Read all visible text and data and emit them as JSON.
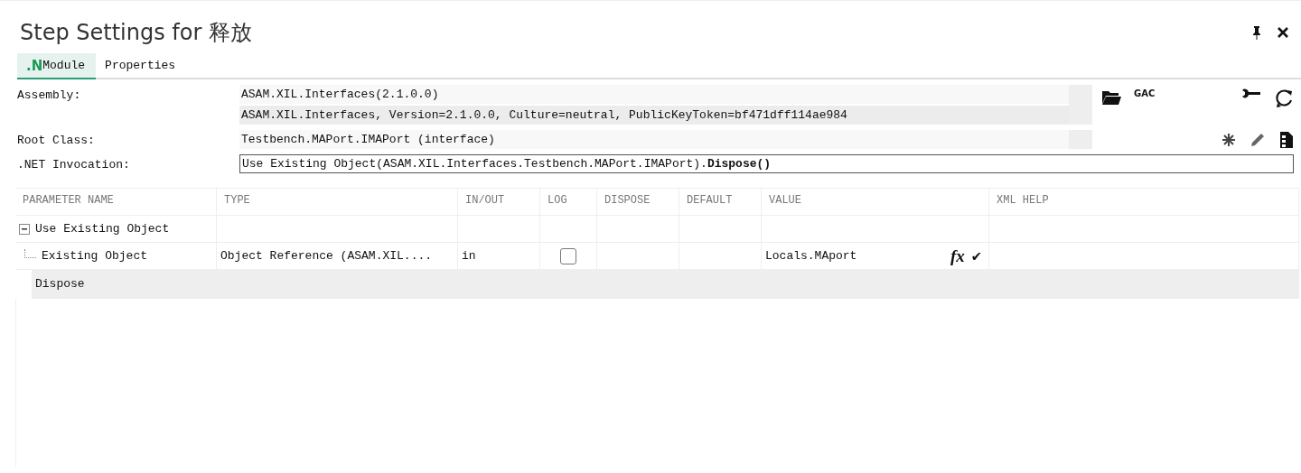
{
  "window": {
    "title": "Step Settings for 释放"
  },
  "tabs": [
    {
      "badge": ".N",
      "label": "Module",
      "selected": true
    },
    {
      "label": "Properties",
      "selected": false
    }
  ],
  "form": {
    "assembly": {
      "label": "Assembly:",
      "value": "ASAM.XIL.Interfaces(2.1.0.0)",
      "full_name": "ASAM.XIL.Interfaces, Version=2.1.0.0, Culture=neutral, PublicKeyToken=bf471dff114ae984",
      "gac": "GAC"
    },
    "root_class": {
      "label": "Root Class:",
      "value": "Testbench.MAPort.IMAPort (interface)"
    },
    "invocation": {
      "label": ".NET Invocation:",
      "value": "Use Existing Object(ASAM.XIL.Interfaces.Testbench.MAPort.IMAPort).**Dispose()**"
    }
  },
  "table": {
    "columns": [
      "PARAMETER NAME",
      "TYPE",
      "IN/OUT",
      "LOG",
      "DISPOSE",
      "DEFAULT",
      "VALUE",
      "XML HELP"
    ],
    "rows": [
      {
        "name": "Use Existing Object",
        "expanded": true,
        "children": [
          {
            "name": "Existing Object",
            "type": "Object Reference (ASAM.XIL....",
            "in_out": "in",
            "log": false,
            "value": "Locals.MAport",
            "value_buttons": [
              "fx",
              "✔"
            ]
          }
        ]
      }
    ],
    "method": {
      "name": "Dispose",
      "selected": true
    }
  }
}
